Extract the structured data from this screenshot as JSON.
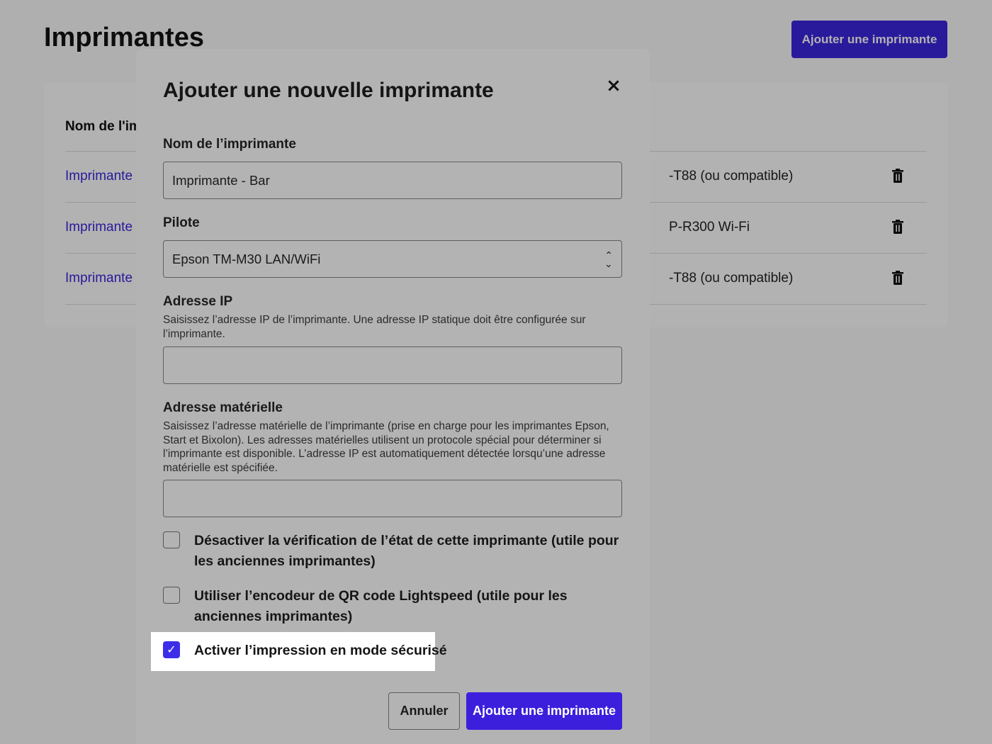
{
  "page": {
    "title": "Imprimantes",
    "add_button": "Ajouter une imprimante",
    "table": {
      "column_name": "Nom de l'im",
      "rows": [
        {
          "name": "Imprimante",
          "model": "-T88 (ou compatible)"
        },
        {
          "name": "Imprimante",
          "model": "P-R300 Wi-Fi"
        },
        {
          "name": "Imprimante",
          "model": "-T88 (ou compatible)"
        }
      ]
    }
  },
  "modal": {
    "title": "Ajouter une nouvelle imprimante",
    "close_icon": "×",
    "printer_name": {
      "label": "Nom de l’imprimante",
      "value": "Imprimante - Bar"
    },
    "driver": {
      "label": "Pilote",
      "selected": "Epson TM-M30 LAN/WiFi"
    },
    "ip_address": {
      "label": "Adresse IP",
      "help": "Saisissez l’adresse IP de l’imprimante. Une adresse IP statique doit être configurée sur l’imprimante.",
      "value": ""
    },
    "hardware_address": {
      "label": "Adresse matérielle",
      "help": "Saisissez l’adresse matérielle de l’imprimante (prise en charge pour les imprimantes Epson, Start et Bixolon). Les adresses matérielles utilisent un protocole spécial pour déterminer si l’imprimante est disponible. L’adresse IP est automatiquement détectée lorsqu’une adresse matérielle est spécifiée.",
      "value": ""
    },
    "options": [
      {
        "label": "Désactiver la vérification de l’état de cette imprimante (utile pour les anciennes imprimantes)",
        "checked": false
      },
      {
        "label": "Utiliser l’encodeur de QR code Lightspeed (utile pour les anciennes imprimantes)",
        "checked": false
      },
      {
        "label": "Activer l’impression en mode sécurisé",
        "checked": true
      }
    ],
    "cancel_button": "Annuler",
    "submit_button": "Ajouter une imprimante"
  },
  "colors": {
    "accent": "#3b26e0",
    "overlay": "#7a7a7a",
    "modal_bg": "#b3b3b3"
  }
}
